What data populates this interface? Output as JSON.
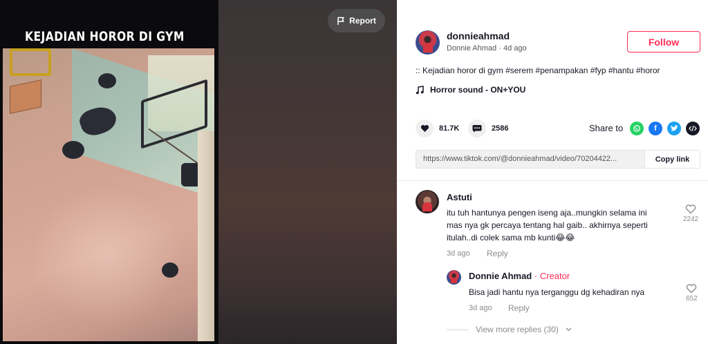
{
  "video": {
    "overlay_title": "KEJADIAN HOROR DI GYM",
    "report_label": "Report"
  },
  "author": {
    "username": "donnieahmad",
    "display_name": "Donnie Ahmad",
    "posted": "4d ago",
    "separator": "·",
    "follow_label": "Follow"
  },
  "post": {
    "caption": ":: Kejadian horor di gym #serem #penampakan #fyp #hantu #horor",
    "music": "Horror sound - ON+YOU",
    "likes": "81.7K",
    "comments": "2586",
    "share_label": "Share to",
    "link": "https://www.tiktok.com/@donnieahmad/video/70204422...",
    "copy_label": "Copy link"
  },
  "comments": [
    {
      "name": "Astuti",
      "text_lines": [
        "itu tuh hantunya pengen iseng aja..mungkin selama ini",
        "mas nya gk percaya tentang hal gaib.. akhirnya seperti",
        "itulah..di colek sama mb kunti😂😂"
      ],
      "time": "3d ago",
      "reply_label": "Reply",
      "likes": "2242"
    }
  ],
  "reply": {
    "name": "Donnie Ahmad",
    "creator_tag": "· Creator",
    "text": "Bisa jadi hantu nya terganggu dg kehadiran nya",
    "time": "3d ago",
    "reply_label": "Reply",
    "likes": "652"
  },
  "more_replies": "View more replies (30)",
  "colors": {
    "accent": "#fe2c55",
    "whatsapp": "#25d366",
    "facebook": "#1877f2",
    "twitter": "#1da1f2",
    "embed": "#161823"
  }
}
